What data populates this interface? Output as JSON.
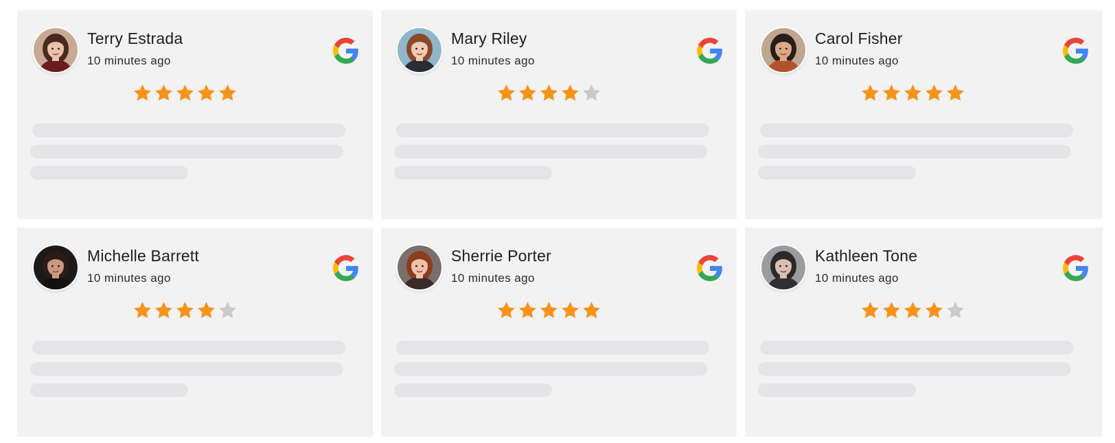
{
  "reviews": [
    {
      "name": "Terry Estrada",
      "time": "10 minutes ago",
      "rating": 5,
      "avatar": "avatar-woman-red-lips",
      "source": "google"
    },
    {
      "name": "Mary Riley",
      "time": "10 minutes ago",
      "rating": 4,
      "avatar": "avatar-woman-bob-hair",
      "source": "google"
    },
    {
      "name": "Carol Fisher",
      "time": "10 minutes ago",
      "rating": 5,
      "avatar": "avatar-woman-smiling",
      "source": "google"
    },
    {
      "name": "Michelle Barrett",
      "time": "10 minutes ago",
      "rating": 4,
      "avatar": "avatar-woman-dark",
      "source": "google"
    },
    {
      "name": "Sherrie Porter",
      "time": "10 minutes ago",
      "rating": 5,
      "avatar": "avatar-woman-auburn",
      "source": "google"
    },
    {
      "name": "Kathleen Tone",
      "time": "10 minutes ago",
      "rating": 4,
      "avatar": "avatar-woman-grey",
      "source": "google"
    }
  ],
  "max_rating": 5,
  "colors": {
    "card_bg": "#f2f2f3",
    "placeholder_bar": "#e4e4e6",
    "star_filled": "#f7931a",
    "star_empty": "#c9c9cc",
    "google_blue": "#4285F4",
    "google_red": "#EA4335",
    "google_yellow": "#FBBC05",
    "google_green": "#34A853"
  }
}
